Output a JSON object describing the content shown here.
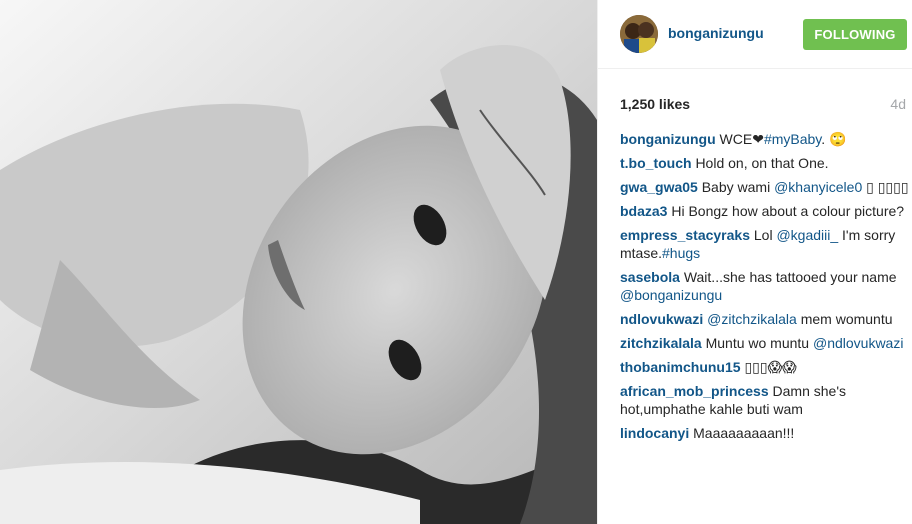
{
  "post": {
    "author": "bonganizungu",
    "follow_label": "FOLLOWING",
    "likes": "1,250 likes",
    "time": "4d"
  },
  "comments": [
    {
      "user": "bonganizungu",
      "parts": [
        {
          "t": "text",
          "v": "WCE❤"
        },
        {
          "t": "tag",
          "v": "#myBaby"
        },
        {
          "t": "text",
          "v": ". 🙄"
        }
      ]
    },
    {
      "user": "t.bo_touch",
      "parts": [
        {
          "t": "text",
          "v": "Hold on, on that One."
        }
      ]
    },
    {
      "user": "gwa_gwa05",
      "parts": [
        {
          "t": "text",
          "v": "Baby wami "
        },
        {
          "t": "mention",
          "v": "@khanyicele0"
        },
        {
          "t": "text",
          "v": " ▯ ▯▯▯▯"
        }
      ]
    },
    {
      "user": "bdaza3",
      "parts": [
        {
          "t": "text",
          "v": "Hi Bongz how about a colour picture?"
        }
      ]
    },
    {
      "user": "empress_stacyraks",
      "parts": [
        {
          "t": "text",
          "v": "Lol "
        },
        {
          "t": "mention",
          "v": "@kgadiii_"
        },
        {
          "t": "text",
          "v": " I'm sorry mtase."
        },
        {
          "t": "tag",
          "v": "#hugs"
        }
      ]
    },
    {
      "user": "sasebola",
      "parts": [
        {
          "t": "text",
          "v": "Wait...she has tattooed your name "
        },
        {
          "t": "mention",
          "v": "@bonganizungu"
        }
      ]
    },
    {
      "user": "ndlovukwazi",
      "parts": [
        {
          "t": "mention",
          "v": "@zitchzikalala"
        },
        {
          "t": "text",
          "v": " mem womuntu"
        }
      ]
    },
    {
      "user": "zitchzikalala",
      "parts": [
        {
          "t": "text",
          "v": "Muntu wo muntu "
        },
        {
          "t": "mention",
          "v": "@ndlovukwazi"
        }
      ]
    },
    {
      "user": "thobanimchunu15",
      "parts": [
        {
          "t": "text",
          "v": "▯▯▯😱😱"
        }
      ]
    },
    {
      "user": "african_mob_princess",
      "parts": [
        {
          "t": "text",
          "v": "Damn she's hot,umphathe kahle buti wam"
        }
      ]
    },
    {
      "user": "lindocanyi",
      "parts": [
        {
          "t": "text",
          "v": "Maaaaaaaaan!!!"
        }
      ]
    }
  ]
}
